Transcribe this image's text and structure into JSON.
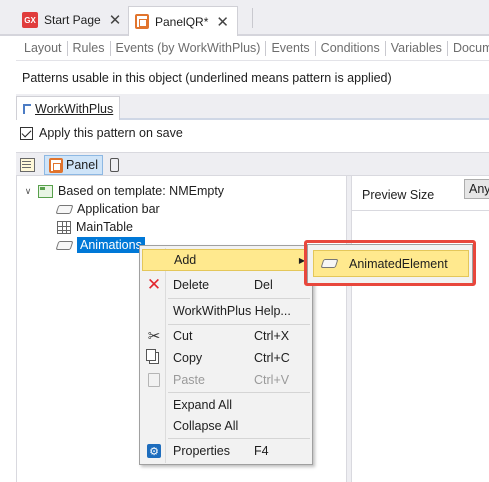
{
  "document_tabs": [
    {
      "label": "Start Page",
      "icon": "genexus-icon",
      "active": false
    },
    {
      "label": "PanelQR",
      "modified": "*",
      "icon": "panel-icon",
      "active": true
    }
  ],
  "editor_tabs": [
    "Layout",
    "Rules",
    "Events (by WorkWithPlus)",
    "Events",
    "Conditions",
    "Variables",
    "Docume"
  ],
  "patterns_caption": "Patterns usable in this object (underlined means pattern is applied)",
  "pattern_tab": {
    "label": "WorkWithPlus",
    "icon": "workwithplus-icon"
  },
  "apply_pattern": {
    "label": "Apply this pattern on save",
    "checked": true
  },
  "toolbar": {
    "panel_label": "Panel"
  },
  "tree": {
    "root": {
      "label": "Based on template: NMEmpty",
      "icon": "template-icon",
      "expanded": true
    },
    "children": [
      {
        "label": "Application bar",
        "icon": "node-icon"
      },
      {
        "label": "MainTable",
        "icon": "table-icon"
      },
      {
        "label": "Animations",
        "icon": "node-icon",
        "selected": true
      }
    ]
  },
  "preview": {
    "size_label": "Preview Size",
    "size_value": "Any"
  },
  "context_menu": {
    "items": [
      {
        "label": "Add",
        "submenu": true,
        "highlighted": true
      },
      {
        "label": "Delete",
        "shortcut": "Del",
        "icon": "delete-x-icon"
      },
      {
        "label": "WorkWithPlus Help..."
      },
      {
        "label": "Cut",
        "shortcut": "Ctrl+X",
        "icon": "scissors-icon"
      },
      {
        "label": "Copy",
        "shortcut": "Ctrl+C",
        "icon": "copy-icon"
      },
      {
        "label": "Paste",
        "shortcut": "Ctrl+V",
        "icon": "paste-icon",
        "disabled": true
      },
      {
        "label": "Expand All"
      },
      {
        "label": "Collapse All"
      },
      {
        "label": "Properties",
        "shortcut": "F4",
        "icon": "properties-icon"
      }
    ]
  },
  "submenu": {
    "label": "AnimatedElement",
    "icon": "node-icon"
  },
  "colors": {
    "selection": "#0078d7",
    "menu_highlight": "#ffe98e",
    "callout_frame": "#e8473c"
  }
}
